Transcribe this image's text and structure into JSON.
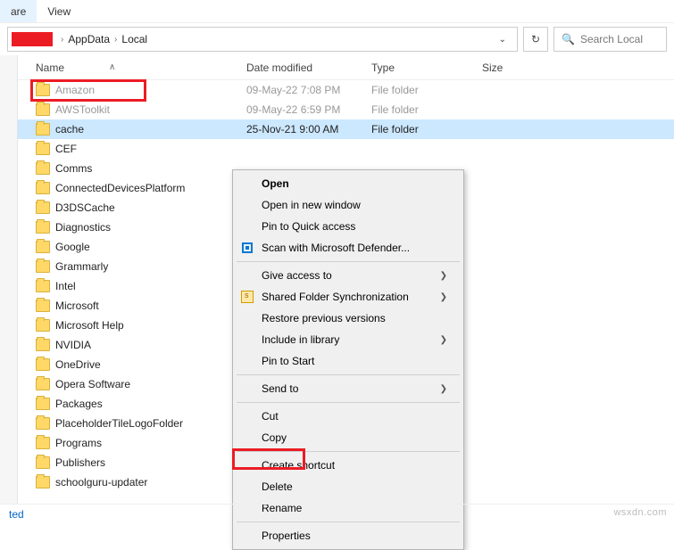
{
  "menubar": {
    "share": "are",
    "view": "View"
  },
  "breadcrumb": {
    "items": [
      "AppData",
      "Local"
    ],
    "dropdown_glyph": "⌄"
  },
  "refresh_glyph": "↻",
  "search": {
    "icon": "🔍",
    "placeholder": "Search Local"
  },
  "columns": {
    "name": "Name",
    "date": "Date modified",
    "type": "Type",
    "size": "Size",
    "sort_glyph": "∧"
  },
  "files": [
    {
      "name": "Amazon",
      "date": "09-May-22 7:08 PM",
      "type": "File folder",
      "disabled": true
    },
    {
      "name": "AWSToolkit",
      "date": "09-May-22 6:59 PM",
      "type": "File folder",
      "disabled": true
    },
    {
      "name": "cache",
      "date": "25-Nov-21 9:00 AM",
      "type": "File folder",
      "selected": true
    },
    {
      "name": "CEF",
      "date": "",
      "type": ""
    },
    {
      "name": "Comms",
      "date": "",
      "type": ""
    },
    {
      "name": "ConnectedDevicesPlatform",
      "date": "",
      "type": ""
    },
    {
      "name": "D3DSCache",
      "date": "",
      "type": ""
    },
    {
      "name": "Diagnostics",
      "date": "",
      "type": ""
    },
    {
      "name": "Google",
      "date": "",
      "type": ""
    },
    {
      "name": "Grammarly",
      "date": "",
      "type": ""
    },
    {
      "name": "Intel",
      "date": "",
      "type": ""
    },
    {
      "name": "Microsoft",
      "date": "",
      "type": ""
    },
    {
      "name": "Microsoft Help",
      "date": "",
      "type": ""
    },
    {
      "name": "NVIDIA",
      "date": "",
      "type": ""
    },
    {
      "name": "OneDrive",
      "date": "",
      "type": ""
    },
    {
      "name": "Opera Software",
      "date": "",
      "type": ""
    },
    {
      "name": "Packages",
      "date": "",
      "type": ""
    },
    {
      "name": "PlaceholderTileLogoFolder",
      "date": "",
      "type": ""
    },
    {
      "name": "Programs",
      "date": "",
      "type": ""
    },
    {
      "name": "Publishers",
      "date": "",
      "type": ""
    },
    {
      "name": "schoolguru-updater",
      "date": "",
      "type": ""
    }
  ],
  "context_menu": {
    "open": "Open",
    "open_new_window": "Open in new window",
    "pin_quick": "Pin to Quick access",
    "defender": "Scan with Microsoft Defender...",
    "give_access": "Give access to",
    "shared_sync": "Shared Folder Synchronization",
    "restore_prev": "Restore previous versions",
    "include_lib": "Include in library",
    "pin_start": "Pin to Start",
    "send_to": "Send to",
    "cut": "Cut",
    "copy": "Copy",
    "create_shortcut": "Create shortcut",
    "delete": "Delete",
    "rename": "Rename",
    "properties": "Properties",
    "arrow": "❯"
  },
  "statusbar": {
    "text": "ted"
  },
  "watermark": "wsxdn.com"
}
